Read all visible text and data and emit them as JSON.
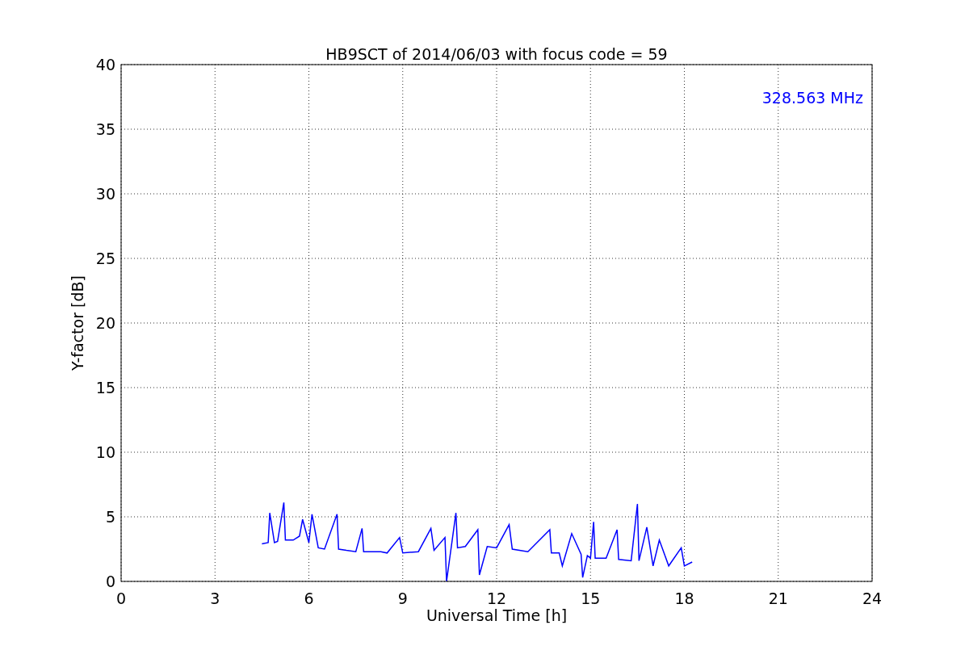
{
  "chart": {
    "chart_data": {
      "type": "line",
      "title": "HB9SCT of 2014/06/03 with focus code = 59",
      "xlabel": "Universal Time [h]",
      "ylabel": "Y-factor [dB]",
      "xlim": [
        0,
        24
      ],
      "ylim": [
        0,
        40
      ],
      "xticks": [
        0,
        3,
        6,
        9,
        12,
        15,
        18,
        21,
        24
      ],
      "yticks": [
        0,
        5,
        10,
        15,
        20,
        25,
        30,
        35,
        40
      ],
      "grid": true,
      "x": [
        4.5,
        4.7,
        4.75,
        4.9,
        5.0,
        5.2,
        5.25,
        5.5,
        5.7,
        5.8,
        6.0,
        6.1,
        6.3,
        6.5,
        6.9,
        6.95,
        7.2,
        7.5,
        7.7,
        7.75,
        8.0,
        8.3,
        8.5,
        8.9,
        9.0,
        9.5,
        9.9,
        10.0,
        10.35,
        10.4,
        10.7,
        10.75,
        11.0,
        11.4,
        11.45,
        11.7,
        12.0,
        12.4,
        12.5,
        13.0,
        13.7,
        13.75,
        14.0,
        14.1,
        14.4,
        14.7,
        14.75,
        14.9,
        15.0,
        15.1,
        15.15,
        15.5,
        15.85,
        15.9,
        16.3,
        16.5,
        16.55,
        16.8,
        17.0,
        17.2,
        17.5,
        17.9,
        18.0,
        18.25
      ],
      "series": [
        {
          "color": "#0000ff",
          "values": [
            2.9,
            3.0,
            5.3,
            3.0,
            3.1,
            6.1,
            3.2,
            3.2,
            3.5,
            4.8,
            3.0,
            5.2,
            2.6,
            2.5,
            5.2,
            2.5,
            2.4,
            2.3,
            4.1,
            2.3,
            2.3,
            2.3,
            2.2,
            3.4,
            2.2,
            2.3,
            4.1,
            2.4,
            3.4,
            0,
            5.3,
            2.6,
            2.7,
            4.0,
            0.5,
            2.7,
            2.6,
            4.4,
            2.5,
            2.3,
            4.0,
            2.2,
            2.2,
            1.2,
            3.7,
            2.1,
            0.3,
            2.0,
            1.8,
            4.6,
            1.8,
            1.8,
            4.0,
            1.7,
            1.6,
            6.0,
            1.6,
            4.2,
            1.2,
            3.2,
            1.2,
            2.6,
            1.2,
            1.5
          ]
        }
      ],
      "annotations": [
        {
          "text": "328.563 MHz"
        }
      ]
    }
  }
}
